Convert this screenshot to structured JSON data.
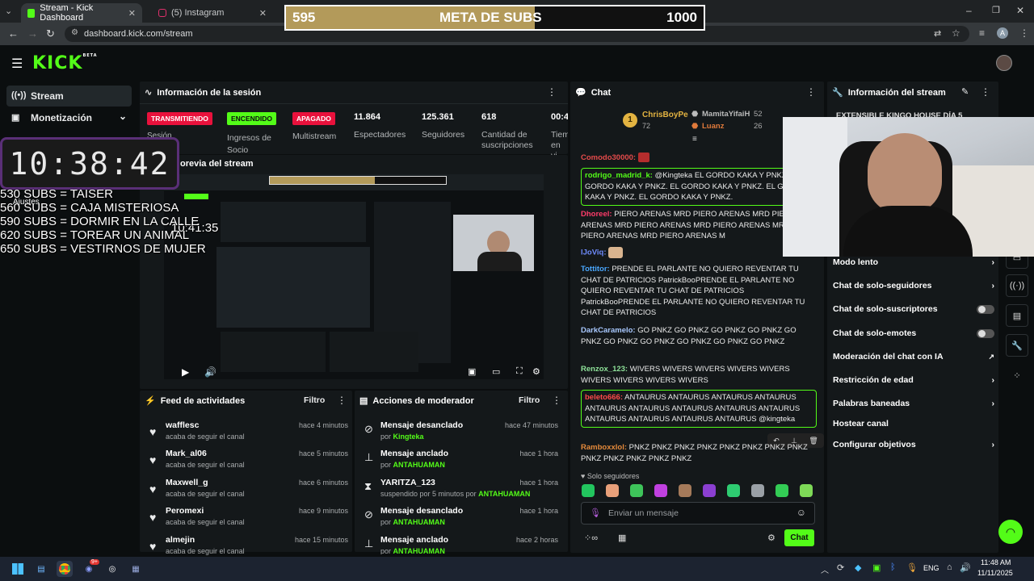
{
  "browser": {
    "tabs": [
      {
        "label": "Stream - Kick Dashboard",
        "active": true
      },
      {
        "label": "(5) Instagram",
        "active": false
      }
    ],
    "url": "dashboard.kick.com/stream"
  },
  "goal_bar": {
    "current": "595",
    "title": "META DE SUBS",
    "target": "1000",
    "progress": 0.595
  },
  "brand": {
    "logo": "KICK",
    "sup": "BETA"
  },
  "sidebar": {
    "items": [
      {
        "label": "Stream"
      },
      {
        "label": "Monetización"
      }
    ]
  },
  "overlay": {
    "clock": "10:38:42",
    "mini_clock": "10:41:35",
    "sub_goals": [
      "530 SUBS = TAISER",
      "560 SUBS =  CAJA MISTERIOSA",
      "590 SUBS = DORMIR EN LA CALLE",
      "620 SUBS = TOREAR UN ANIMAL",
      "650 SUBS = VESTIRNOS DE MUJER"
    ],
    "ajustes": "Ajustes"
  },
  "session": {
    "title": "Información de la sesión",
    "badges": [
      "TRANSMITIENDO",
      "ENCENDIDO",
      "APAGADO"
    ],
    "badge_sub": [
      "Ingresos de Socio",
      "Multistream",
      "Sesión"
    ],
    "stats": [
      {
        "value": "11.864",
        "label": "Espectadores"
      },
      {
        "value": "125.361",
        "label": "Seguidores"
      },
      {
        "value": "618",
        "label": "Cantidad de suscripciones"
      },
      {
        "value": "00:4",
        "label": "Tiem en vi"
      }
    ]
  },
  "preview": {
    "title": "Vista previa del stream",
    "title_visible": "orevia del stream"
  },
  "feed": {
    "title": "Feed de actividades",
    "filter": "Filtro",
    "items": [
      {
        "name": "wafflesc",
        "sub": "acaba de seguir el canal",
        "time": "hace 4 minutos"
      },
      {
        "name": "Mark_al06",
        "sub": "acaba de seguir el canal",
        "time": "hace 5 minutos"
      },
      {
        "name": "Maxwell_g",
        "sub": "acaba de seguir el canal",
        "time": "hace 6 minutos"
      },
      {
        "name": "Peromexi",
        "sub": "acaba de seguir el canal",
        "time": "hace 9 minutos"
      },
      {
        "name": "almejin",
        "sub": "acaba de seguir el canal",
        "time": "hace 15 minutos"
      }
    ]
  },
  "mod": {
    "title": "Acciones de moderador",
    "filter": "Filtro",
    "items": [
      {
        "name": "Mensaje desanclado",
        "pre": "por",
        "who": "Kingteka",
        "time": "hace 47 minutos",
        "icon": "unpin-icon"
      },
      {
        "name": "Mensaje anclado",
        "pre": "por",
        "who": "ANTAHUAMAN",
        "time": "hace 1 hora",
        "icon": "pin-icon"
      },
      {
        "name": "YARITZA_123",
        "pre": "suspendido por 5 minutos por",
        "who": "ANTAHUAMAN",
        "time": "hace 1 hora",
        "icon": "hourglass-icon"
      },
      {
        "name": "Mensaje desanclado",
        "pre": "por",
        "who": "ANTAHUAMAN",
        "time": "hace 1 hora",
        "icon": "unpin-icon"
      },
      {
        "name": "Mensaje anclado",
        "pre": "por",
        "who": "ANTAHUAMAN",
        "time": "hace 2 horas",
        "icon": "pin-icon"
      }
    ]
  },
  "chat": {
    "title": "Chat",
    "top": [
      {
        "rank": "1",
        "name": "ChrisBoyPe",
        "count": "72"
      },
      {
        "name": "MamitaYifaiH",
        "count": "52"
      },
      {
        "name": "Luanz",
        "count": "26"
      }
    ],
    "messages": [
      {
        "user": "Comodo30000:",
        "text": ""
      },
      {
        "user": "rodrigo_madrid_k:",
        "text": "@Kingteka EL GORDO KAKA Y PNKZ. EL GORDO KAKA Y PNKZ. EL GORDO KAKA Y PNKZ. EL GORDO KAKA Y PNKZ. EL GORDO KAKA Y PNKZ."
      },
      {
        "user": "Dhoreel:",
        "text": "PIERO ARENAS MRD  PIERO ARENAS MRD  PIERO ARENAS MRD  PIERO ARENAS MRD  PIERO ARENAS MRD  PIERO ARENAS MRD  PIERO ARENAS M"
      },
      {
        "user": "lJoViq:",
        "text": ""
      },
      {
        "user": "Tottitor:",
        "text": "PRENDE EL PARLANTE NO QUIERO REVENTAR TU CHAT DE PATRICIOS  PatrickBooPRENDE EL PARLANTE NO QUIERO REVENTAR TU CHAT DE PATRICIOS  PatrickBooPRENDE EL PARLANTE NO QUIERO REVENTAR TU CHAT DE PATRICIOS"
      },
      {
        "user": "DarkCaramelo:",
        "text": "GO PNKZ  GO PNKZ  GO PNKZ  GO PNKZ  GO PNKZ  GO PNKZ  GO PNKZ  GO PNKZ  GO PNKZ  GO PNKZ"
      },
      {
        "user": "Renzox_123:",
        "text": "WIVERS WIVERS WIVERS WIVERS WIVERS WIVERS WIVERS WIVERS WIVERS"
      },
      {
        "user": "beleto666:",
        "text": "ANTAURUS  ANTAURUS  ANTAURUS  ANTAURUS  ANTAURUS  ANTAURUS  ANTAURUS  ANTAURUS  ANTAURUS  ANTAURUS  ANTAURUS  ANTAURUS  ANTAURUS  @kingteka"
      },
      {
        "user": "Ramboxxlol:",
        "text": "PNKZ PNKZ PNKZ PNKZ PNKZ PNKZ PNKZ PNKZ PNKZ PNKZ PNKZ PNKZ PNKZ"
      }
    ],
    "followers_only": "Solo seguidores",
    "placeholder": "Enviar un mensaje",
    "send": "Chat"
  },
  "stream_info": {
    "title": "Información del stream",
    "obscured_title": "EXTENSIBLE KINGO HOUSE DÍA 5",
    "settings": [
      {
        "label": "Modo lento",
        "ctrl": "chevron"
      },
      {
        "label": "Chat de solo-seguidores",
        "ctrl": "chevron"
      },
      {
        "label": "Chat de solo-suscriptores",
        "ctrl": "toggle"
      },
      {
        "label": "Chat de solo-emotes",
        "ctrl": "toggle"
      },
      {
        "label": "Moderación del chat con IA",
        "ctrl": "external"
      },
      {
        "label": "Restricción de edad",
        "ctrl": "chevron"
      },
      {
        "label": "Palabras baneadas",
        "ctrl": "chevron"
      },
      {
        "label": "Hostear canal",
        "ctrl": "none"
      },
      {
        "label": "Configurar objetivos",
        "ctrl": "chevron"
      }
    ]
  },
  "taskbar": {
    "lang": "ENG",
    "time": "11:48 AM",
    "date": "11/11/2025",
    "discord_badge": "9+"
  },
  "colors": {
    "brand": "#53fc18",
    "live": "#e9113c",
    "bg": "#0b0e0f",
    "panel": "#14181a",
    "goal_fill": "#b39a5a"
  }
}
